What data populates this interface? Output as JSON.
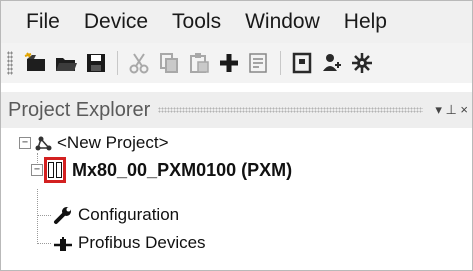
{
  "menu": {
    "items": [
      "File",
      "Device",
      "Tools",
      "Window",
      "Help"
    ]
  },
  "toolbar": {
    "icons": [
      "new-project-icon",
      "open-icon",
      "save-icon",
      "cut-icon",
      "copy-icon",
      "paste-icon",
      "add-icon",
      "properties-icon",
      "book-icon",
      "users-icon",
      "network-icon"
    ]
  },
  "panel": {
    "title": "Project Explorer",
    "pin_glyph": "▾ ⊥ ×"
  },
  "tree": {
    "root": {
      "label": "<New Project>",
      "expander": "−"
    },
    "device": {
      "label": "Mx80_00_PXM0100 (PXM)",
      "expander": "−"
    },
    "children": [
      {
        "label": "Configuration"
      },
      {
        "label": "Profibus Devices"
      }
    ]
  },
  "colors": {
    "highlight_box": "#d32020",
    "device_icon": "#111111"
  }
}
